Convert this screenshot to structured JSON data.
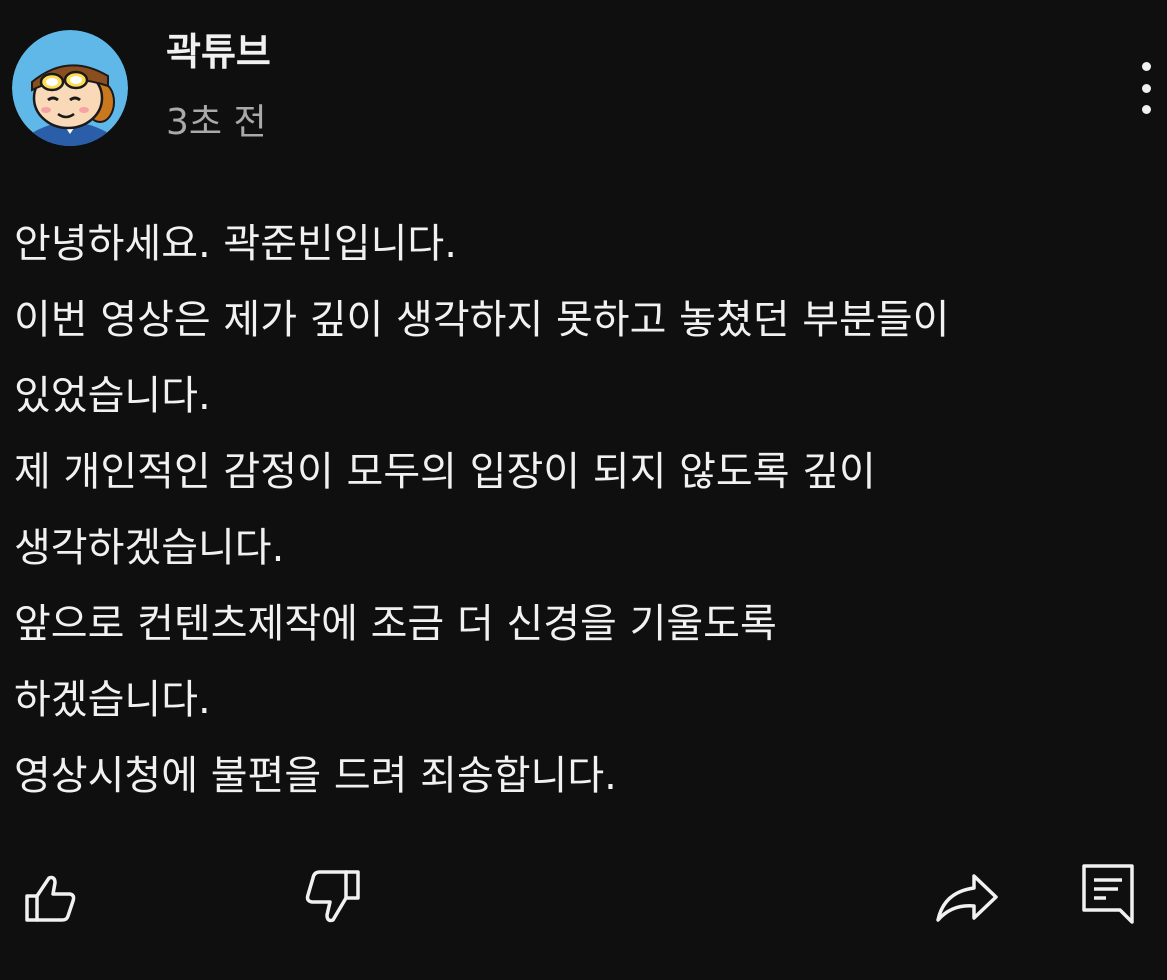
{
  "post": {
    "author": "곽튜브",
    "timestamp": "3초 전",
    "lines": [
      "안녕하세요. 곽준빈입니다.",
      "이번 영상은 제가 깊이 생각하지 못하고 놓쳤던 부분들이",
      "있었습니다.",
      "제 개인적인 감정이 모두의 입장이 되지 않도록 깊이",
      "생각하겠습니다.",
      "앞으로 컨텐츠제작에 조금 더 신경을 기울도록",
      "하겠습니다.",
      "영상시청에 불편을 드려 죄송합니다."
    ]
  },
  "actions": {
    "icons": [
      "like-icon",
      "dislike-icon",
      "share-icon",
      "comment-icon",
      "more-vertical-icon"
    ]
  },
  "colors": {
    "background": "#0f0f0f",
    "text_primary": "#f1f1f1",
    "text_secondary": "#aaaaaa",
    "avatar_bg": "#5fb8e8"
  }
}
